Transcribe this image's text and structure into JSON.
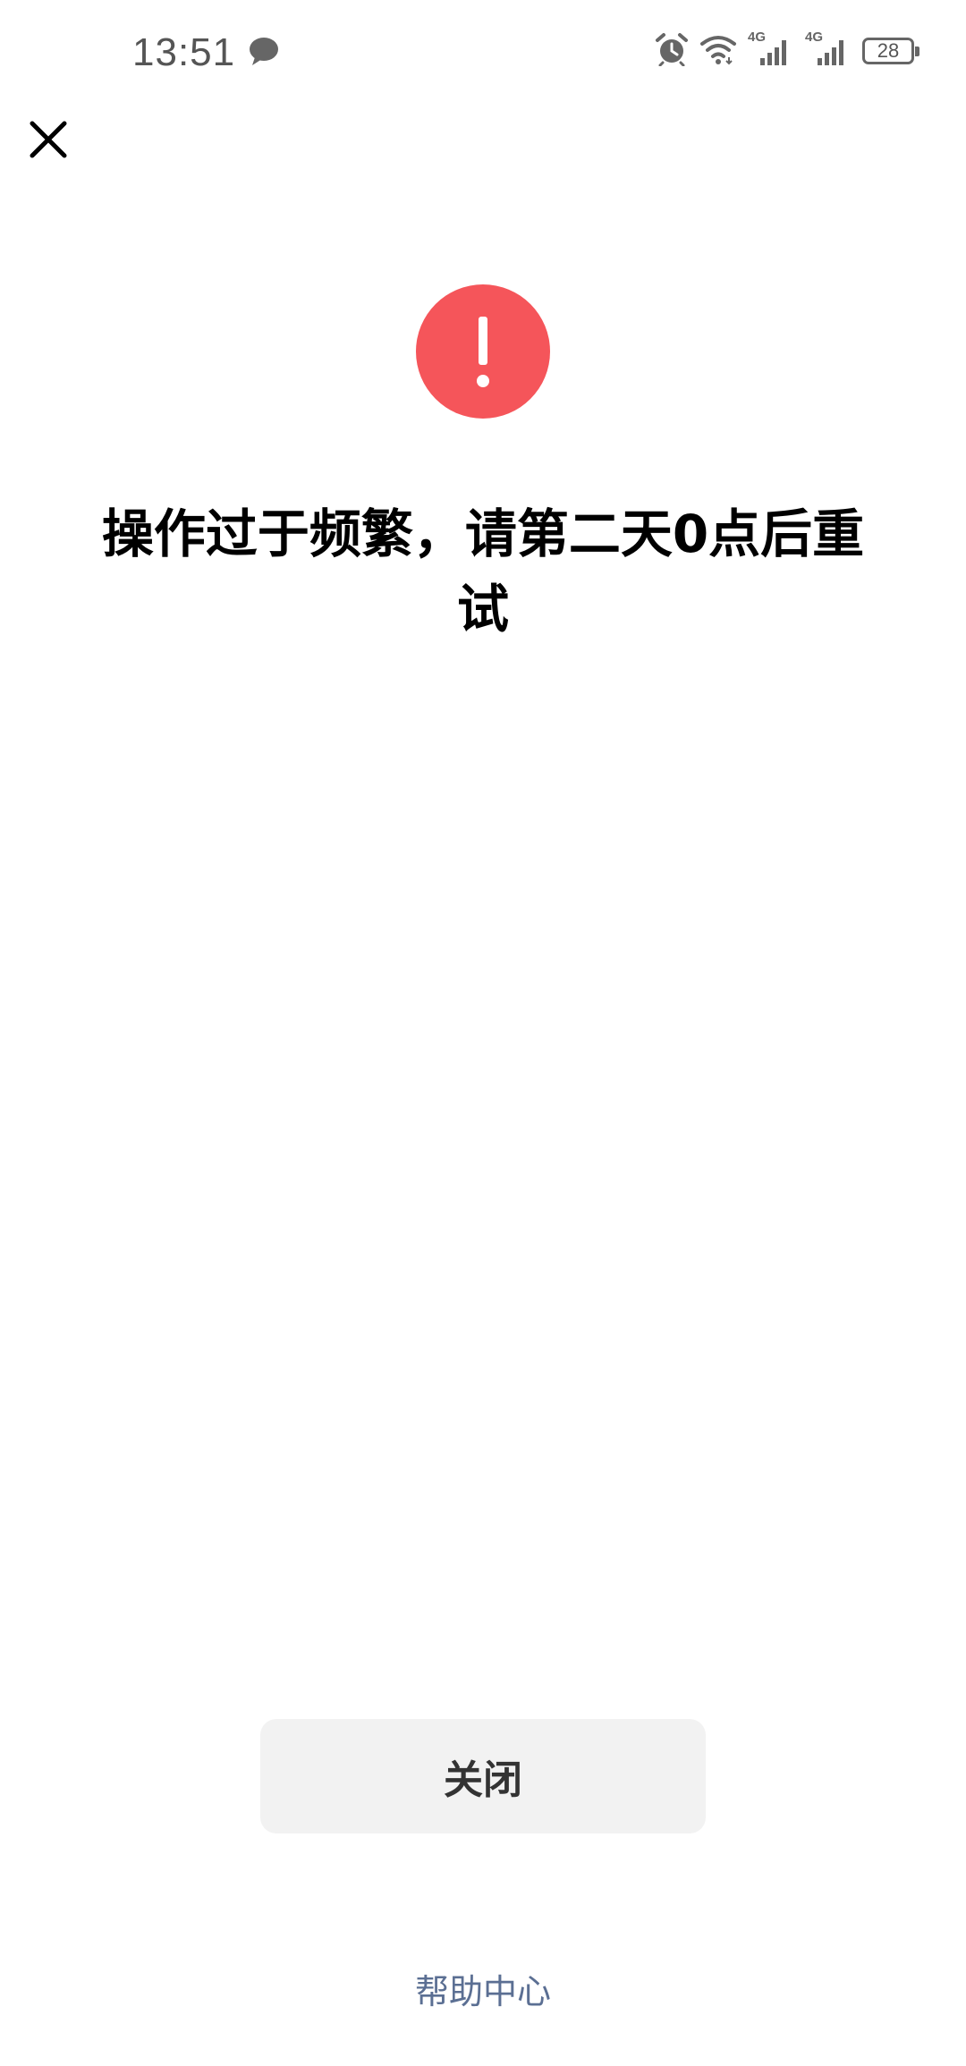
{
  "status_bar": {
    "time": "13:51",
    "icons": [
      "chat-bubble-icon",
      "alarm-icon",
      "wifi-icon",
      "signal-4g-icon",
      "signal-4g-icon",
      "battery-icon"
    ],
    "signal_label_1": "4G",
    "signal_label_2": "4G",
    "battery_level": "28"
  },
  "header": {
    "close_icon": "close-icon"
  },
  "result": {
    "icon": "exclamation-icon",
    "icon_color": "#f5555a",
    "message": "操作过于频繁，请第二天0点后重试"
  },
  "actions": {
    "close_label": "关闭",
    "help_label": "帮助中心",
    "help_color": "#5b6f93"
  }
}
